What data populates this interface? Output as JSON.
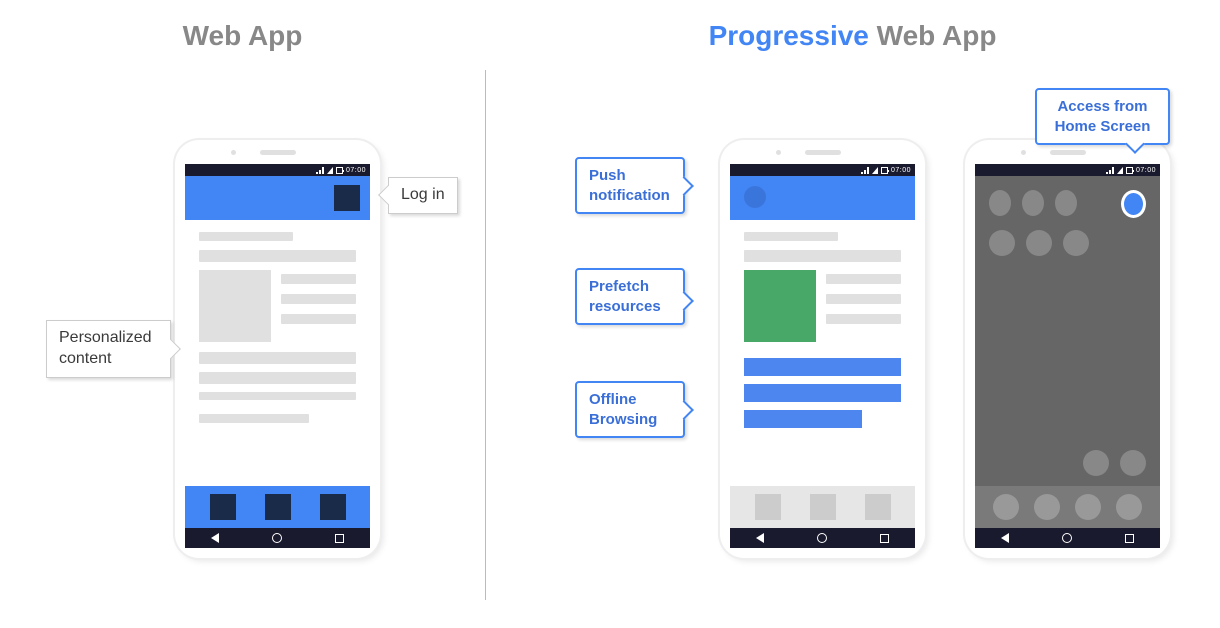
{
  "titles": {
    "left": "Web App",
    "right_accent": "Progressive",
    "right_rest": " Web App"
  },
  "statusbar": {
    "time": "07:00"
  },
  "callouts": {
    "login": "Log in",
    "personalized": "Personalized content",
    "push": "Push notification",
    "prefetch": "Prefetch resources",
    "offline": "Offline Browsing",
    "homescreen": "Access from Home Screen"
  }
}
